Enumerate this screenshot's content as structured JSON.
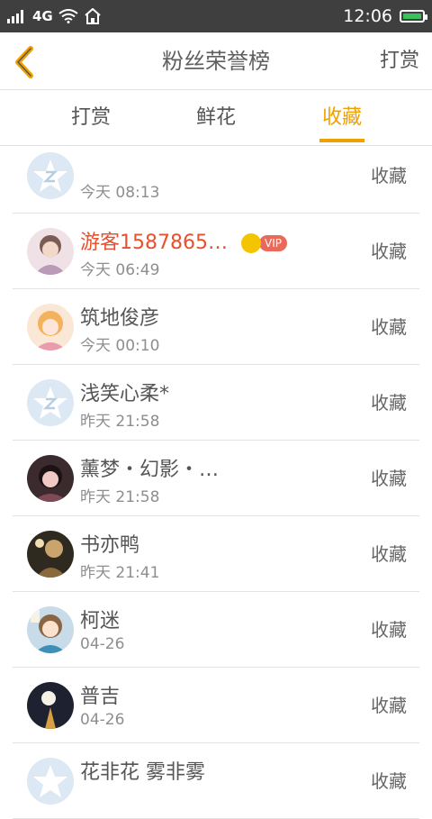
{
  "status_bar": {
    "network": "4G",
    "time": "12:06"
  },
  "header": {
    "title": "粉丝荣誉榜",
    "right_action": "打赏"
  },
  "tabs": [
    {
      "label": "打赏",
      "active": false
    },
    {
      "label": "鲜花",
      "active": false
    },
    {
      "label": "收藏",
      "active": true
    }
  ],
  "accent_color": "#f0a000",
  "list": [
    {
      "name": "",
      "time": "今天 08:13",
      "action": "收藏",
      "avatar": "default-avatar"
    },
    {
      "name": "游客1587865…",
      "time": "今天 06:49",
      "action": "收藏",
      "avatar": "user-avatar",
      "vip_label": "VIP"
    },
    {
      "name": "筑地俊彦",
      "time": "今天 00:10",
      "action": "收藏",
      "avatar": "user-avatar"
    },
    {
      "name": "浅笑心柔*",
      "time": "昨天 21:58",
      "action": "收藏",
      "avatar": "default-avatar"
    },
    {
      "name": "薰梦・幻影・…",
      "time": "昨天 21:58",
      "action": "收藏",
      "avatar": "user-avatar"
    },
    {
      "name": "书亦鸭",
      "time": "昨天 21:41",
      "action": "收藏",
      "avatar": "user-avatar"
    },
    {
      "name": "柯迷",
      "time": "04-26",
      "action": "收藏",
      "avatar": "user-avatar"
    },
    {
      "name": "普吉",
      "time": "04-26",
      "action": "收藏",
      "avatar": "user-avatar"
    },
    {
      "name": "花非花 雾非雾",
      "time": "",
      "action": "收藏",
      "avatar": "default-avatar"
    }
  ]
}
